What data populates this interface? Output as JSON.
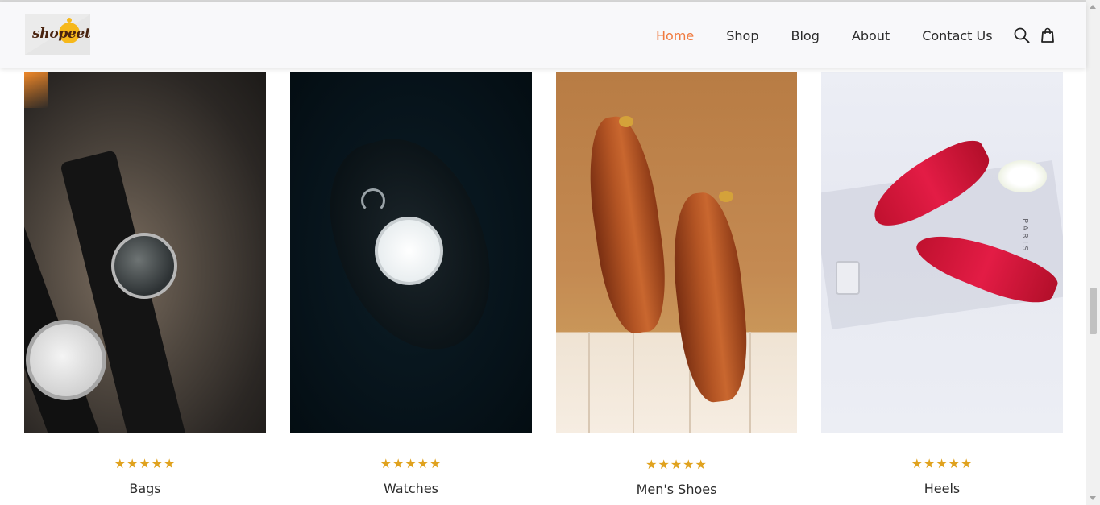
{
  "brand": {
    "logo_text": "shopeet"
  },
  "nav": {
    "items": [
      "Home",
      "Shop",
      "Blog",
      "About",
      "Contact Us"
    ],
    "active": "Home"
  },
  "header_icons": [
    "search-icon",
    "shopping-bag-icon"
  ],
  "colors": {
    "accent": "#f07a3f",
    "star": "#e0a21e",
    "navbar_bg": "#f8f8fa"
  },
  "products": [
    {
      "title": "Bags",
      "rating_stars": "★★★★★"
    },
    {
      "title": "Watches",
      "rating_stars": "★★★★★"
    },
    {
      "title": "Men's Shoes",
      "rating_stars": "★★★★★"
    },
    {
      "title": "Heels",
      "rating_stars": "★★★★★"
    }
  ],
  "image_text": {
    "heels_packaging": "PARIS"
  }
}
